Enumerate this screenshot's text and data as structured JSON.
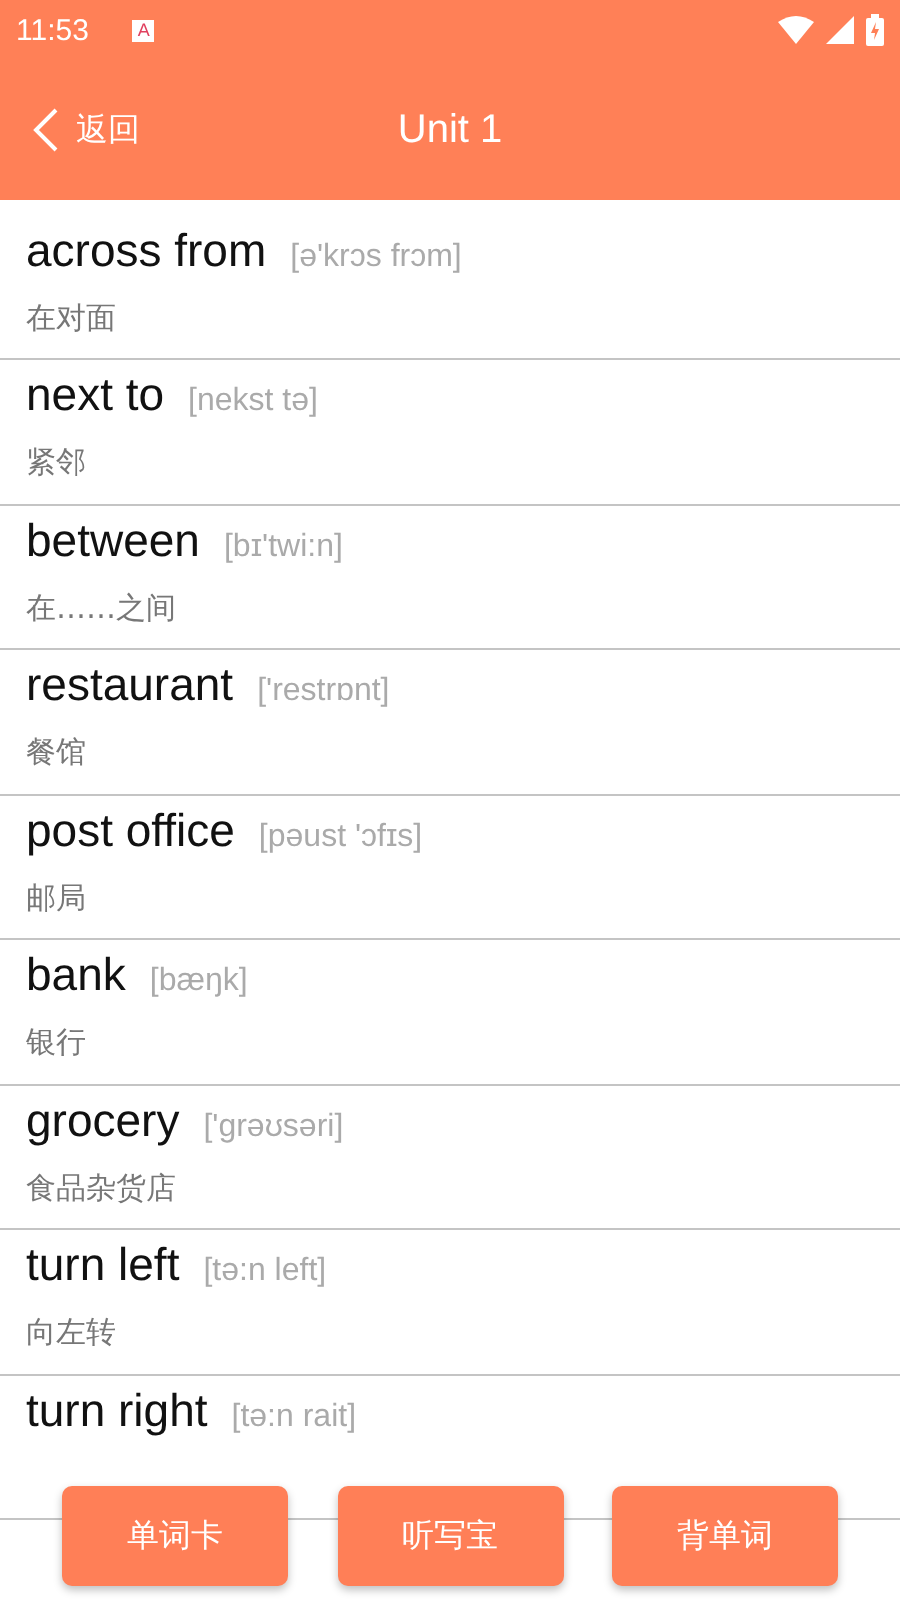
{
  "status_bar": {
    "time": "11:53",
    "notification": "A"
  },
  "header": {
    "back": "返回",
    "title": "Unit 1"
  },
  "words": [
    {
      "word": "across from",
      "phonetic": "[ə'krɔs frɔm]",
      "meaning": "在对面"
    },
    {
      "word": "next to",
      "phonetic": "[nekst tə]",
      "meaning": "紧邻"
    },
    {
      "word": "between",
      "phonetic": "[bɪ'twi:n]",
      "meaning": "在……之间"
    },
    {
      "word": "restaurant",
      "phonetic": "['restrɒnt]",
      "meaning": "餐馆"
    },
    {
      "word": "post office",
      "phonetic": "[pəust 'ɔfɪs]",
      "meaning": "邮局"
    },
    {
      "word": "bank",
      "phonetic": "[bæŋk]",
      "meaning": "银行"
    },
    {
      "word": "grocery",
      "phonetic": "['grəʊsəri]",
      "meaning": "食品杂货店"
    },
    {
      "word": "turn left",
      "phonetic": "[tə:n left]",
      "meaning": "向左转"
    },
    {
      "word": "turn right",
      "phonetic": "[tə:n rait]"
    }
  ],
  "buttons": [
    "单词卡",
    "听写宝",
    "背单词"
  ]
}
